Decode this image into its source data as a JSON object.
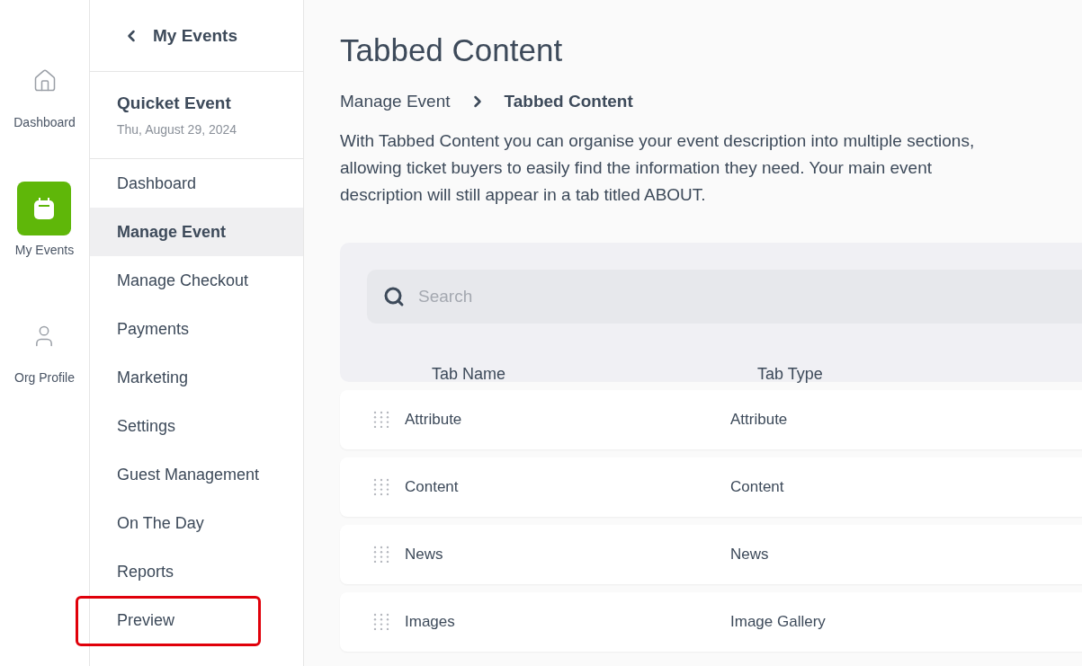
{
  "rail": [
    {
      "kind": "home",
      "label": "Dashboard",
      "selected": false
    },
    {
      "kind": "calendar",
      "label": "My Events",
      "selected": true
    },
    {
      "kind": "user",
      "label": "Org Profile",
      "selected": false
    }
  ],
  "sidebar": {
    "back_label": "My Events",
    "event_name": "Quicket Event",
    "event_date": "Thu, August 29, 2024",
    "items": [
      {
        "label": "Dashboard",
        "selected": false,
        "highlighted": false
      },
      {
        "label": "Manage Event",
        "selected": true,
        "highlighted": false
      },
      {
        "label": "Manage Checkout",
        "selected": false,
        "highlighted": false
      },
      {
        "label": "Payments",
        "selected": false,
        "highlighted": false
      },
      {
        "label": "Marketing",
        "selected": false,
        "highlighted": false
      },
      {
        "label": "Settings",
        "selected": false,
        "highlighted": false
      },
      {
        "label": "Guest Management",
        "selected": false,
        "highlighted": false
      },
      {
        "label": "On The Day",
        "selected": false,
        "highlighted": false
      },
      {
        "label": "Reports",
        "selected": false,
        "highlighted": false
      },
      {
        "label": "Preview",
        "selected": false,
        "highlighted": true
      }
    ]
  },
  "page": {
    "title": "Tabbed Content",
    "breadcrumb": [
      "Manage Event",
      "Tabbed Content"
    ],
    "description": "With Tabbed Content you can organise your event description into multiple sections, allowing ticket buyers to easily find the information they need. Your main event description will still appear in a tab titled ABOUT."
  },
  "table": {
    "search": {
      "placeholder": "Search"
    },
    "columns": [
      "Tab Name",
      "Tab Type"
    ],
    "rows": [
      {
        "name": "Attribute",
        "type": "Attribute"
      },
      {
        "name": "Content",
        "type": "Content"
      },
      {
        "name": "News",
        "type": "News"
      },
      {
        "name": "Images",
        "type": "Image Gallery"
      }
    ]
  }
}
